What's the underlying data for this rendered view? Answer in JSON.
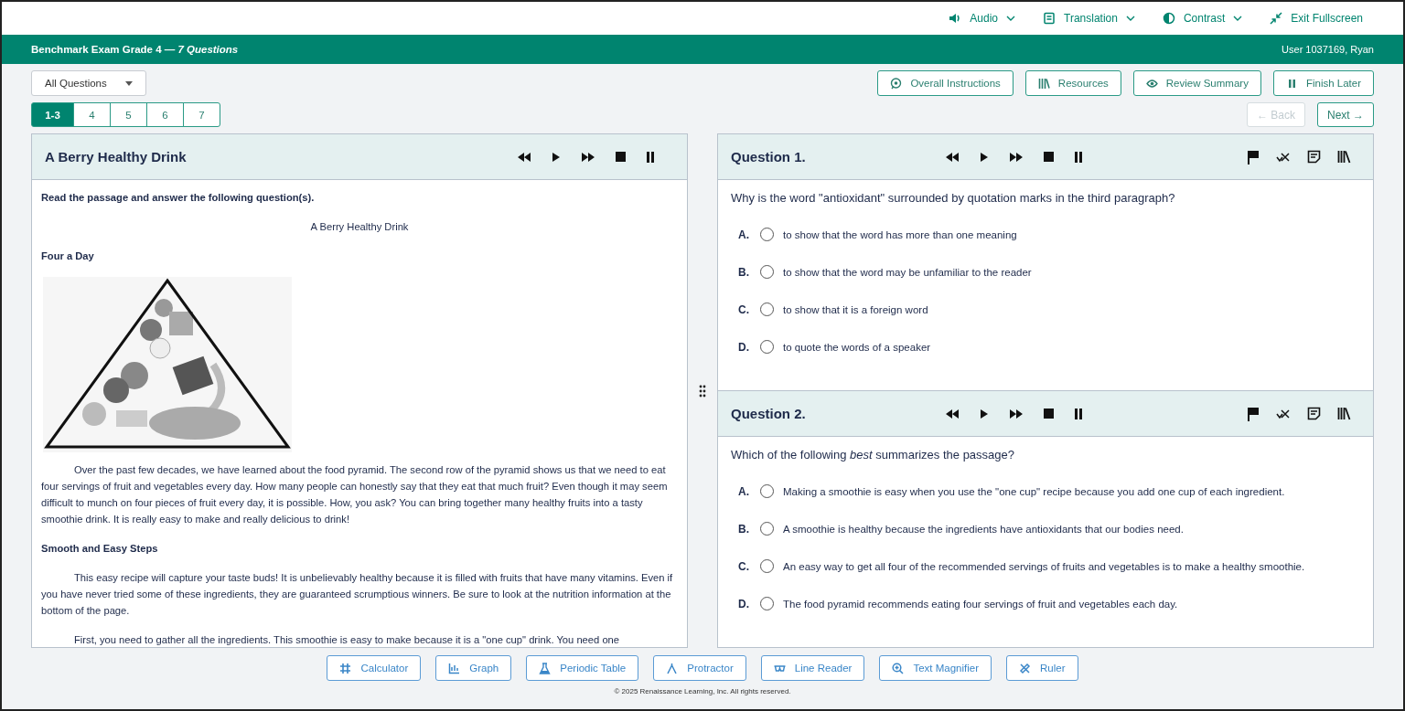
{
  "top_menu": [
    {
      "label": "Audio",
      "dropdown": true
    },
    {
      "label": "Translation",
      "dropdown": true
    },
    {
      "label": "Contrast",
      "dropdown": true
    },
    {
      "label": "Exit Fullscreen",
      "dropdown": false
    }
  ],
  "header": {
    "exam_title": "Benchmark Exam Grade 4 —",
    "question_count": "7 Questions",
    "user": "User 1037169, Ryan"
  },
  "filter": {
    "value": "All Questions"
  },
  "actions": [
    "Overall Instructions",
    "Resources",
    "Review Summary",
    "Finish Later"
  ],
  "question_tabs": [
    {
      "label": "1-3",
      "selected": true
    },
    {
      "label": "4",
      "selected": false
    },
    {
      "label": "5",
      "selected": false
    },
    {
      "label": "6",
      "selected": false
    },
    {
      "label": "7",
      "selected": false
    }
  ],
  "nav": {
    "back": {
      "label": "← Back",
      "disabled": true
    },
    "next": {
      "label": "Next →",
      "disabled": false
    }
  },
  "passage": {
    "title": "A Berry Healthy Drink",
    "blocks": [
      {
        "kind": "instruction",
        "text": "Read the passage and answer the following question(s)."
      },
      {
        "kind": "title",
        "text": "A Berry Healthy Drink"
      },
      {
        "kind": "heading",
        "text": "Four a Day"
      },
      {
        "kind": "image"
      },
      {
        "kind": "paragraph",
        "text": "Over the past few decades, we have learned about the food pyramid. The second row of the pyramid shows us that we need to eat four servings of fruit and vegetables every day. How many people can honestly say that they eat that much fruit? Even though it may seem difficult to munch on four pieces of fruit every day, it is possible. How, you ask? You can bring together many healthy fruits into a tasty smoothie drink. It is really easy to make and really delicious to drink!"
      },
      {
        "kind": "heading",
        "text": "Smooth and Easy Steps"
      },
      {
        "kind": "paragraph",
        "text": "This easy recipe will capture your taste buds! It is unbelievably healthy because it is filled with fruits that have many vitamins. Even if you have never tried some of these ingredients, they are guaranteed scrumptious winners. Be sure to look at the nutrition information at the bottom of the page."
      },
      {
        "kind": "paragraph",
        "text": "First, you need to gather all the ingredients. This smoothie is easy to make because it is a \"one cup\" drink. You need one"
      }
    ]
  },
  "questions": [
    {
      "title": "Question 1.",
      "prompt": "Why is the word \"antioxidant\" surrounded by quotation marks in the third paragraph?",
      "choices": [
        {
          "letter": "A.",
          "text": "to show that the word has more than one meaning",
          "selected": false
        },
        {
          "letter": "B.",
          "text": "to show that the word may be unfamiliar to the reader",
          "selected": false
        },
        {
          "letter": "C.",
          "text": "to show that it is a foreign word",
          "selected": false
        },
        {
          "letter": "D.",
          "text": "to quote the words of a speaker",
          "selected": false
        }
      ]
    },
    {
      "title": "Question 2.",
      "prompt": "Which of the following *best* summarizes the passage?",
      "choices": [
        {
          "letter": "A.",
          "text": "Making a smoothie is easy when you use the \"one cup\" recipe because you add one cup of each ingredient.",
          "selected": false
        },
        {
          "letter": "B.",
          "text": "A smoothie is healthy because the ingredients have antioxidants that our bodies need.",
          "selected": false
        },
        {
          "letter": "C.",
          "text": "An easy way to get all four of the recommended servings of fruits and vegetables is to make a healthy smoothie.",
          "selected": false
        },
        {
          "letter": "D.",
          "text": "The food pyramid recommends eating four servings of fruit and vegetables each day.",
          "selected": false
        }
      ]
    }
  ],
  "tools": [
    "Calculator",
    "Graph",
    "Periodic Table",
    "Protractor",
    "Line Reader",
    "Text Magnifier",
    "Ruler"
  ],
  "footer": "© 2025 Renaissance Learning, Inc. All rights reserved."
}
